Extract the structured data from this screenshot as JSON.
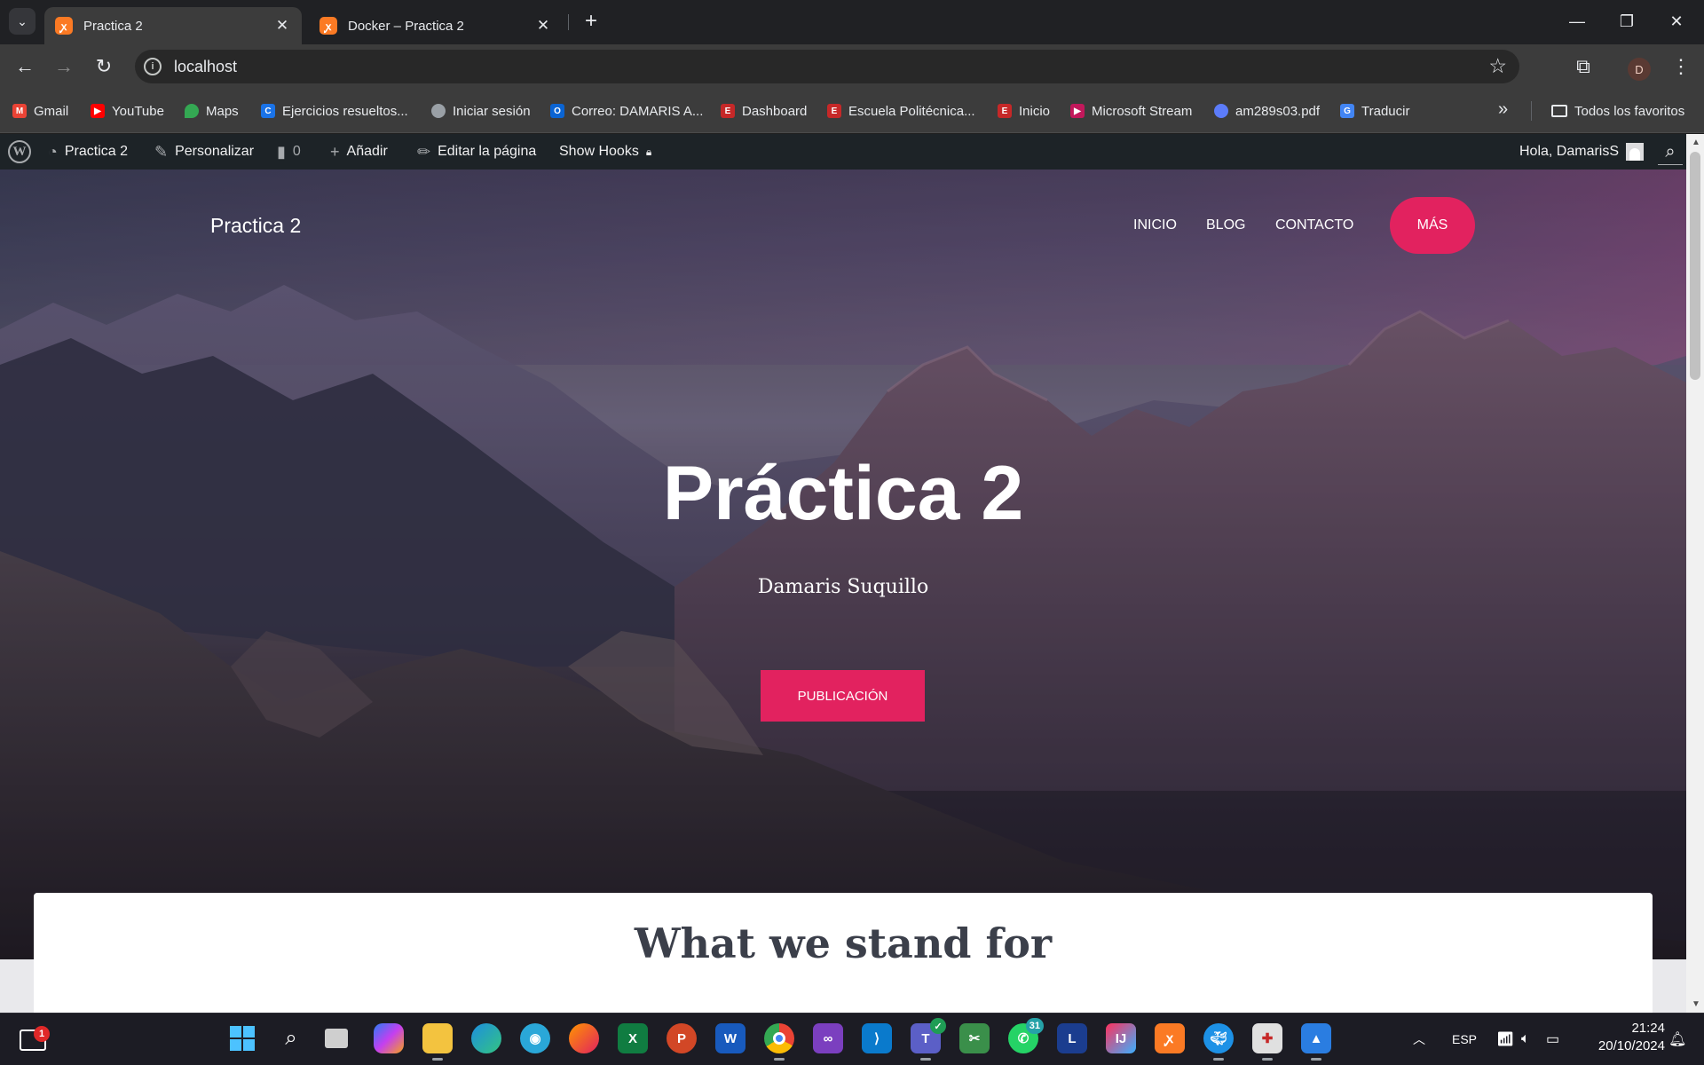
{
  "browser": {
    "tabs": [
      {
        "title": "Practica 2",
        "active": true
      },
      {
        "title": "Docker – Practica 2",
        "active": false
      }
    ],
    "url": "localhost",
    "profile_initial": "D",
    "bookmarks": [
      {
        "label": "Gmail",
        "icon": "gmail-icon",
        "color": "#ea4335"
      },
      {
        "label": "YouTube",
        "icon": "youtube-icon",
        "color": "#ff0000"
      },
      {
        "label": "Maps",
        "icon": "maps-icon",
        "color": "#34a853"
      },
      {
        "label": "Ejercicios resueltos...",
        "icon": "doc-icon",
        "color": "#1a73e8"
      },
      {
        "label": "Iniciar sesión",
        "icon": "globe-icon",
        "color": "#9aa0a6"
      },
      {
        "label": "Correo: DAMARIS A...",
        "icon": "outlook-icon",
        "color": "#0a64d3"
      },
      {
        "label": "Dashboard",
        "icon": "school-icon",
        "color": "#c62828"
      },
      {
        "label": "Escuela Politécnica...",
        "icon": "school-icon",
        "color": "#c62828"
      },
      {
        "label": "Inicio",
        "icon": "school-icon",
        "color": "#c62828"
      },
      {
        "label": "Microsoft Stream",
        "icon": "stream-icon",
        "color": "#c2185b"
      },
      {
        "label": "am289s03.pdf",
        "icon": "globe-icon",
        "color": "#5c7cfa"
      },
      {
        "label": "Traducir",
        "icon": "translate-icon",
        "color": "#4285f4"
      }
    ],
    "all_bookmarks_label": "Todos los favoritos"
  },
  "wp_admin_bar": {
    "site_name": "Practica 2",
    "customize": "Personalizar",
    "comments_count": "0",
    "add_new": "Añadir",
    "edit_page": "Editar la página",
    "show_hooks": "Show Hooks",
    "greeting": "Hola, DamarisS"
  },
  "site": {
    "title": "Practica 2",
    "menu": [
      "INICIO",
      "BLOG",
      "CONTACTO",
      "MÁS"
    ],
    "accent": "#e2225f"
  },
  "hero": {
    "title": "Práctica 2",
    "subtitle": "Damaris Suquillo",
    "button": "PUBLICACIÓN"
  },
  "section": {
    "title": "What we stand for"
  },
  "taskbar": {
    "notification_badge": "1",
    "whatsapp_badge": "31",
    "language": "ESP",
    "time": "21:24",
    "date": "20/10/2024"
  }
}
